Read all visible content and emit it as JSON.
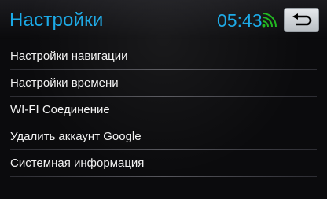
{
  "header": {
    "title": "Настройки",
    "time": "05:43",
    "wifi_icon": "wifi-icon",
    "back_icon": "back-arrow-icon"
  },
  "menu": {
    "items": [
      {
        "label": "Настройки навигации"
      },
      {
        "label": "Настройки времени"
      },
      {
        "label": "WI-FI Соединение"
      },
      {
        "label": "Удалить аккаунт Google"
      },
      {
        "label": "Системная информация"
      }
    ]
  },
  "colors": {
    "accent": "#1aa9e6",
    "wifi": "#1fb81f",
    "text": "#f2f2f2",
    "background": "#0b0b0d"
  }
}
